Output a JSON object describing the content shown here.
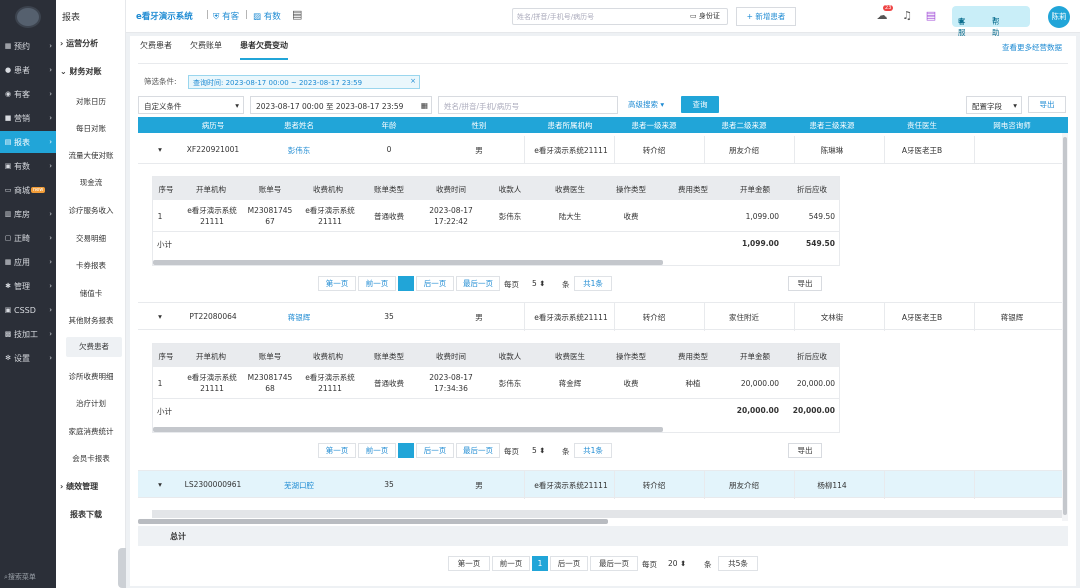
{
  "nav": {
    "items": [
      {
        "label": "预约",
        "icon": "calendar-icon"
      },
      {
        "label": "患者",
        "icon": "user-icon"
      },
      {
        "label": "有客",
        "icon": "eye-icon"
      },
      {
        "label": "营销",
        "icon": "gift-icon"
      },
      {
        "label": "报表",
        "icon": "chart-icon"
      },
      {
        "label": "有数",
        "icon": "data-icon"
      },
      {
        "label": "商城",
        "icon": "shop-icon",
        "badge": "new"
      },
      {
        "label": "库房",
        "icon": "warehouse-icon"
      },
      {
        "label": "正畸",
        "icon": "tooth-icon"
      },
      {
        "label": "应用",
        "icon": "app-icon"
      },
      {
        "label": "管理",
        "icon": "manage-icon"
      },
      {
        "label": "CSSD",
        "icon": "cssd-icon"
      },
      {
        "label": "技加工",
        "icon": "tool-icon"
      },
      {
        "label": "设置",
        "icon": "gear-icon"
      }
    ],
    "search_label": "搜索菜单"
  },
  "sub": {
    "header": "报表",
    "groups": [
      {
        "label": "运营分析",
        "expanded": false
      },
      {
        "label": "财务对账",
        "expanded": true
      },
      {
        "label": "绩效管理",
        "expanded": false
      },
      {
        "label": "报表下载",
        "expanded": false
      }
    ],
    "links": [
      "对账日历",
      "每日对账",
      "流量大使对账",
      "现金流",
      "诊疗服务收入",
      "交易明细",
      "卡券报表",
      "储值卡",
      "其他财务报表",
      "欠费患者",
      "诊所收费明细",
      "治疗计划",
      "家庭消费统计",
      "会员卡报表"
    ]
  },
  "top": {
    "brand": "e看牙演示系统",
    "youke": "有客",
    "youshu": "有数",
    "search_placeholder": "姓名/拼音/手机号/病历号",
    "id_card": "身份证",
    "new_patient": "+ 新增患者",
    "notif_count": "23",
    "kefu": "客服",
    "help": "帮助",
    "avatar": "陈莉"
  },
  "tabs": [
    "欠费患者",
    "欠费账单",
    "患者欠费变动"
  ],
  "more_link": "查看更多经营数据",
  "filter": {
    "label": "筛选条件:",
    "tag": "查询时间: 2023-08-17 00:00 ~ 2023-08-17 23:59",
    "custom": "自定义条件",
    "date_range": "2023-08-17 00:00 至 2023-08-17 23:59",
    "search_placeholder": "姓名/拼音/手机/病历号",
    "adv": "高级搜索",
    "query": "查询",
    "config": "配置字段",
    "export": "导出"
  },
  "columns": [
    "病历号",
    "患者姓名",
    "年龄",
    "性别",
    "患者所属机构",
    "患者一级来源",
    "患者二级来源",
    "患者三级来源",
    "责任医生",
    "网电咨询师"
  ],
  "inner_columns": [
    "序号",
    "开单机构",
    "账单号",
    "收费机构",
    "账单类型",
    "收费时间",
    "收款人",
    "收费医生",
    "操作类型",
    "费用类型",
    "开单金额",
    "折后应收"
  ],
  "patients": [
    {
      "id": "XF220921001",
      "name": "彭伟东",
      "age": "0",
      "gender": "男",
      "org": "e看牙演示系统21111",
      "src1": "转介绍",
      "src2": "朋友介绍",
      "src3": "陈琳琳",
      "doctor": "A牙医老王B",
      "consultant": "",
      "bill": {
        "no": "1",
        "open_org": "e看牙演示系统21111",
        "bill_no": "M2308174567",
        "charge_org": "e看牙演示系统21111",
        "type": "普通收费",
        "time": "2023-08-17 17:22:42",
        "payee": "彭伟东",
        "doctor": "陆大生",
        "op": "收费",
        "fee_type": "",
        "amount": "1,099.00",
        "due": "549.50"
      },
      "subtotal_label": "小计",
      "subtotal_amount": "1,099.00",
      "subtotal_due": "549.50",
      "pager": {
        "first": "第一页",
        "prev": "前一页",
        "next": "后一页",
        "last": "最后一页",
        "per": "每页",
        "size": "5",
        "unit": "条",
        "total": "共1条"
      },
      "export": "导出"
    },
    {
      "id": "PT22080064",
      "name": "蒋银辉",
      "age": "35",
      "gender": "男",
      "org": "e看牙演示系统21111",
      "src1": "转介绍",
      "src2": "家住附近",
      "src3": "文林街",
      "doctor": "A牙医老王B",
      "consultant": "蒋银辉",
      "bill": {
        "no": "1",
        "open_org": "e看牙演示系统21111",
        "bill_no": "M2308174568",
        "charge_org": "e看牙演示系统21111",
        "type": "普通收费",
        "time": "2023-08-17 17:34:36",
        "payee": "彭伟东",
        "doctor": "蒋金辉",
        "op": "收费",
        "fee_type": "种植",
        "amount": "20,000.00",
        "due": "20,000.00"
      },
      "subtotal_label": "小计",
      "subtotal_amount": "20,000.00",
      "subtotal_due": "20,000.00",
      "pager": {
        "first": "第一页",
        "prev": "前一页",
        "next": "后一页",
        "last": "最后一页",
        "per": "每页",
        "size": "5",
        "unit": "条",
        "total": "共1条"
      },
      "export": "导出"
    },
    {
      "id": "LS2300000961",
      "name": "芜湖口腔",
      "age": "35",
      "gender": "男",
      "org": "e看牙演示系统21111",
      "src1": "转介绍",
      "src2": "朋友介绍",
      "src3": "杨柳114",
      "doctor": "",
      "consultant": ""
    }
  ],
  "total_label": "总计",
  "bottom_pager": {
    "first": "第一页",
    "prev": "前一页",
    "page": "1",
    "next": "后一页",
    "last": "最后一页",
    "per": "每页",
    "size": "20",
    "unit": "条",
    "total": "共5条"
  }
}
